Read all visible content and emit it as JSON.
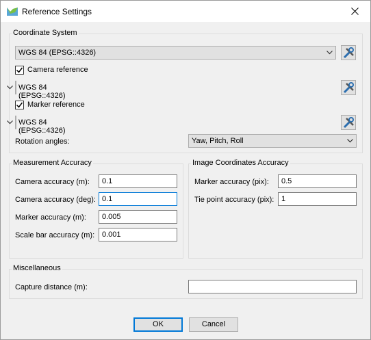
{
  "window": {
    "title": "Reference Settings"
  },
  "coordinate_system": {
    "title": "Coordinate System",
    "crs_value": "WGS 84 (EPSG::4326)",
    "camera_reference": {
      "label": "Camera reference",
      "checked": true,
      "crs_value": "WGS 84 (EPSG::4326)"
    },
    "marker_reference": {
      "label": "Marker reference",
      "checked": true,
      "crs_value": "WGS 84 (EPSG::4326)"
    },
    "rotation_angles": {
      "label": "Rotation angles:",
      "value": "Yaw, Pitch, Roll"
    }
  },
  "measurement_accuracy": {
    "title": "Measurement Accuracy",
    "camera_accuracy_m": {
      "label": "Camera accuracy (m):",
      "value": "0.1"
    },
    "camera_accuracy_deg": {
      "label": "Camera accuracy (deg):",
      "value": "0.1"
    },
    "marker_accuracy_m": {
      "label": "Marker accuracy (m):",
      "value": "0.005"
    },
    "scale_bar_accuracy_m": {
      "label": "Scale bar accuracy (m):",
      "value": "0.001"
    }
  },
  "image_coordinates_accuracy": {
    "title": "Image Coordinates Accuracy",
    "marker_accuracy_pix": {
      "label": "Marker accuracy (pix):",
      "value": "0.5"
    },
    "tie_point_accuracy_pix": {
      "label": "Tie point accuracy (pix):",
      "value": "1"
    }
  },
  "miscellaneous": {
    "title": "Miscellaneous",
    "capture_distance_m": {
      "label": "Capture distance (m):",
      "value": ""
    }
  },
  "buttons": {
    "ok": "OK",
    "cancel": "Cancel"
  },
  "colors": {
    "focus": "#0078d7",
    "background": "#f0f0f0"
  }
}
